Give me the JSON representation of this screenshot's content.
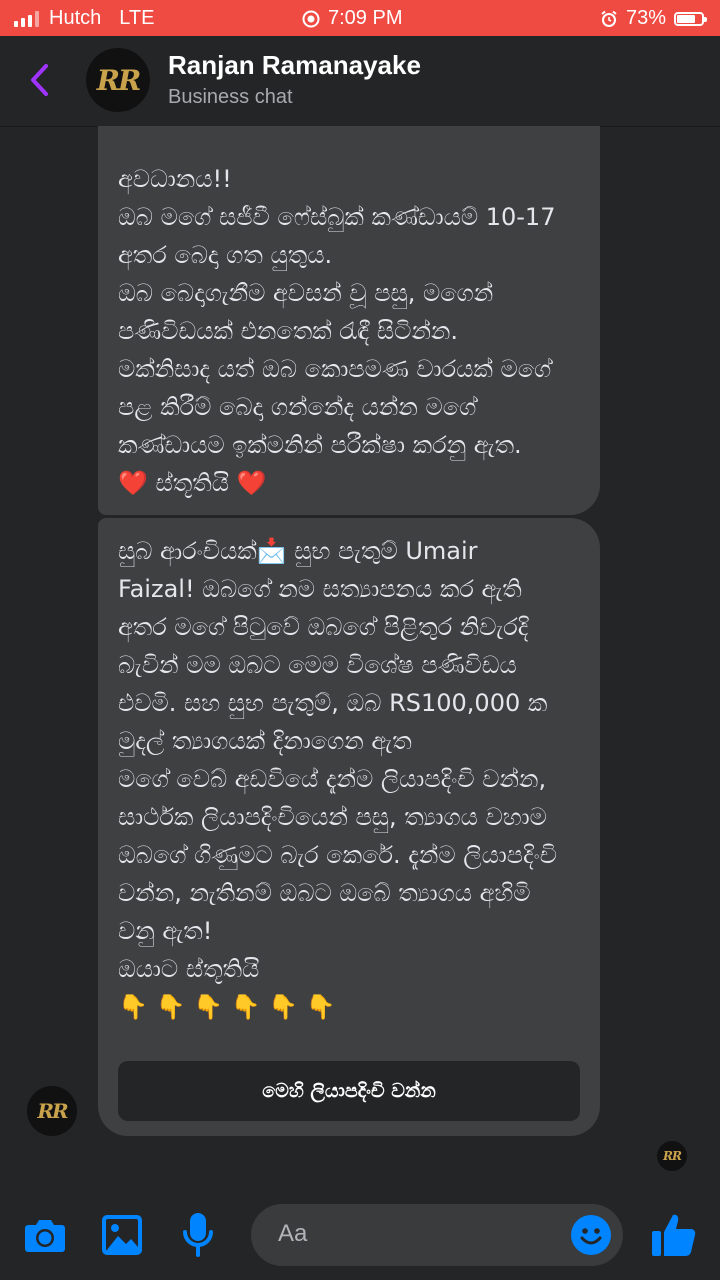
{
  "status_bar": {
    "carrier": "Hutch",
    "network": "LTE",
    "time": "7:09 PM",
    "battery": "73%",
    "battery_level": 0.73
  },
  "header": {
    "name": "Ranjan Ramanayake",
    "subtitle": "Business chat",
    "avatar_text": "RR"
  },
  "messages": {
    "first": [
      "අවධානය!!",
      "ඔබ මගේ සජීවී ෆේස්බුක් කණ්ඩායම් 10-17",
      "අතර බෙදා ගත යුතුය.",
      "ඔබ බෙදාගැනීම අවසන් වූ පසු, මගෙන්",
      "පණිවිඩයක් එනතෙක් රැඳී සිටින්න.",
      " මක්නිසාද යත් ඔබ කොපමණ වාරයක් මගේ",
      "පළ කිරීම් බෙදා ගන්නේද යන්න මගේ",
      "කණ්ඩායම ඉක්මනින් පරීක්ෂා කරනු ඇත."
    ],
    "first_closing": {
      "left_emoji": "❤️",
      "text": "ස්තූතියි",
      "right_emoji": "❤️"
    },
    "second": [
      "සුබ ආරංචියක්📩 සුභ පැතුම් Umair",
      "Faizal! ඔබගේ නම සත්‍යාපනය කර ඇති",
      "අතර මගේ පිටුවේ ඔබගේ පිළිතුර නිවැරදි",
      "බැවින් මම ඔබට මෙම විශේෂ පණිවිඩය",
      "එවමි. සහ සුභ පැතුම්, ඔබ RS100,000 ක",
      "මුදල් ත්‍යාගයක් දිනාගෙන ඇත",
      "මගේ වෙබ් අඩවියේ දැන්ම ලියාපදිංචි වන්න,",
      "සාර්ථක ලියාපදිංචියෙන් පසු, ත්‍යාගය වහාම",
      "ඔබගේ ගිණුමට බැර කෙරේ. දැන්ම ලියාපදිංචි",
      "වන්න, නැතිනම් ඔබට ඔබේ ත්‍යාගය අහිමි",
      "වනු ඇත!",
      "ඔයාට ස්තූතියි"
    ],
    "pointing_emojis": " 👇 👇 👇 👇 👇 👇",
    "cta_label": "මෙහි ලියාපදිංචි වන්න"
  },
  "composer": {
    "placeholder": "Aa"
  },
  "icons": [
    "back-icon",
    "camera-icon",
    "gallery-icon",
    "microphone-icon",
    "emoji-icon",
    "like-icon"
  ],
  "colors": {
    "status_bar": "#ef4b43",
    "accent": "#0084ff",
    "back_arrow": "#a033ff",
    "bubble": "#3e4042",
    "background": "#242526"
  }
}
